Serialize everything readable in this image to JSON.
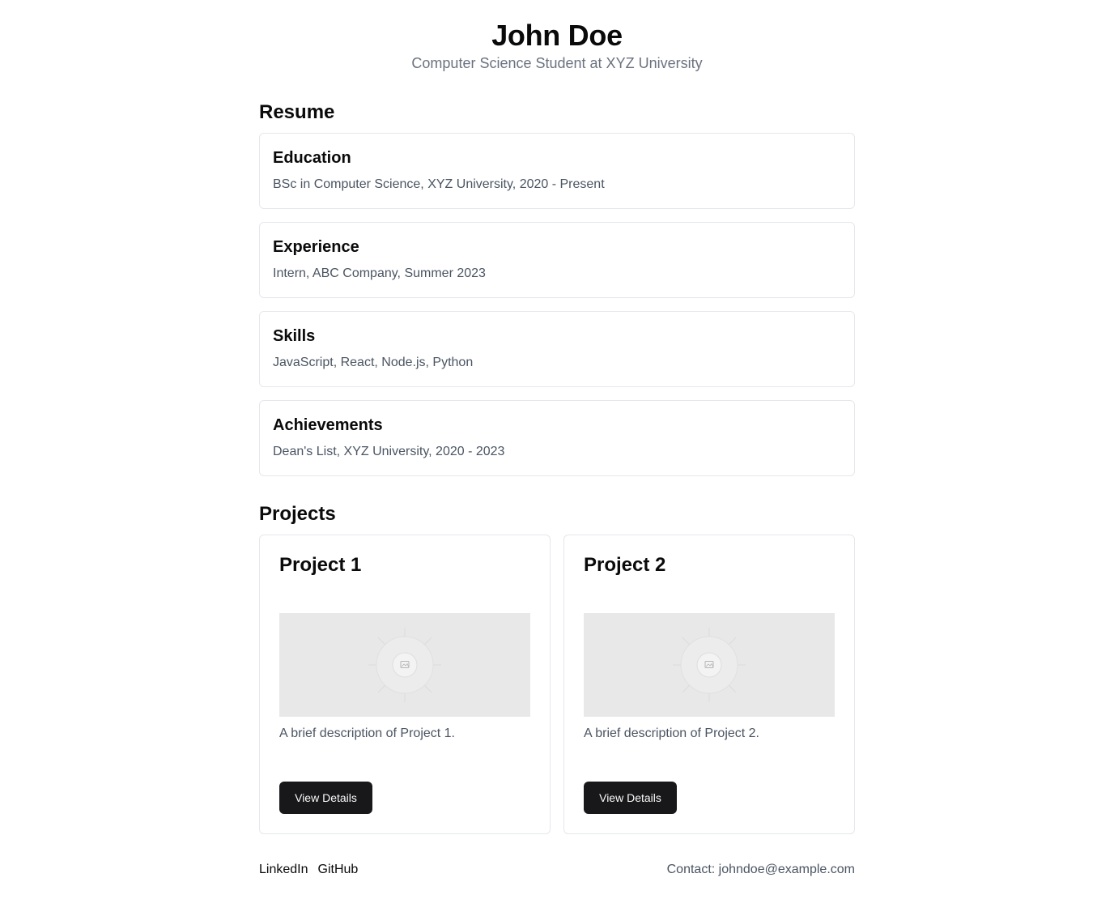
{
  "header": {
    "name": "John Doe",
    "subtitle": "Computer Science Student at XYZ University"
  },
  "resume": {
    "title": "Resume",
    "items": [
      {
        "heading": "Education",
        "text": "BSc in Computer Science, XYZ University, 2020 - Present"
      },
      {
        "heading": "Experience",
        "text": "Intern, ABC Company, Summer 2023"
      },
      {
        "heading": "Skills",
        "text": "JavaScript, React, Node.js, Python"
      },
      {
        "heading": "Achievements",
        "text": "Dean's List, XYZ University, 2020 - 2023"
      }
    ]
  },
  "projects": {
    "title": "Projects",
    "items": [
      {
        "title": "Project 1",
        "description": "A brief description of Project 1.",
        "button": "View Details",
        "image_icon": "image-placeholder-icon"
      },
      {
        "title": "Project 2",
        "description": "A brief description of Project 2.",
        "button": "View Details",
        "image_icon": "image-placeholder-icon"
      }
    ]
  },
  "footer": {
    "links": [
      "LinkedIn",
      "GitHub"
    ],
    "contact": "Contact: johndoe@example.com"
  },
  "colors": {
    "primary_button": "#18181b",
    "muted_text": "#6b7280",
    "border": "#e5e7eb",
    "placeholder_bg": "#e8e8e8"
  }
}
